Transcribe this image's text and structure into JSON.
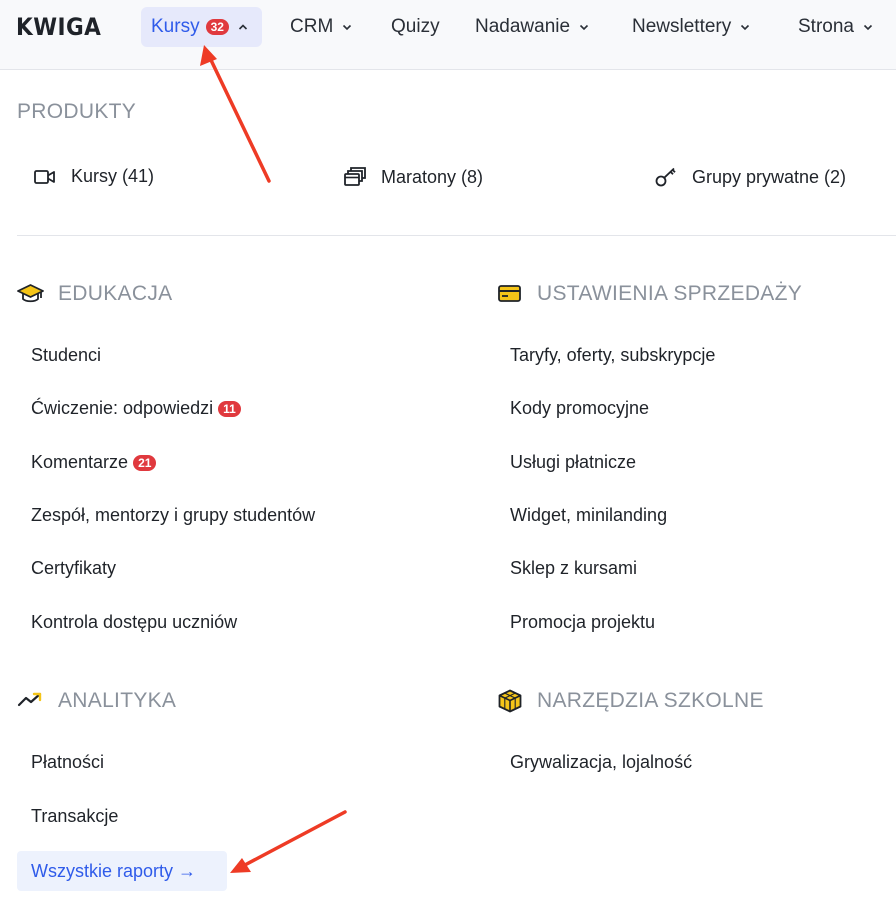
{
  "header": {
    "logo": "KWIGA",
    "nav": [
      {
        "label": "Kursy",
        "badge": "32",
        "active": true
      },
      {
        "label": "CRM"
      },
      {
        "label": "Quizy"
      },
      {
        "label": "Nadawanie"
      },
      {
        "label": "Newslettery"
      },
      {
        "label": "Strona"
      }
    ]
  },
  "products": {
    "heading": "PRODUKTY",
    "items": [
      {
        "label": "Kursy (41)",
        "icon": "video-icon"
      },
      {
        "label": "Maratony (8)",
        "icon": "layers-icon"
      },
      {
        "label": "Grupy prywatne (2)",
        "icon": "key-icon"
      }
    ]
  },
  "education": {
    "heading": "EDUKACJA",
    "icon": "graduation-cap-icon",
    "items": [
      {
        "label": "Studenci"
      },
      {
        "label": "Ćwiczenie: odpowiedzi",
        "badge": "11"
      },
      {
        "label": "Komentarze",
        "badge": "21"
      },
      {
        "label": "Zespół, mentorzy i grupy studentów"
      },
      {
        "label": "Certyfikaty"
      },
      {
        "label": "Kontrola dostępu uczniów"
      }
    ]
  },
  "sales": {
    "heading": "USTAWIENIA SPRZEDAŻY",
    "icon": "credit-card-icon",
    "items": [
      {
        "label": "Taryfy, oferty, subskrypcje"
      },
      {
        "label": "Kody promocyjne"
      },
      {
        "label": "Usługi płatnicze"
      },
      {
        "label": "Widget, minilanding"
      },
      {
        "label": "Sklep z kursami"
      },
      {
        "label": "Promocja projektu"
      }
    ]
  },
  "analytics": {
    "heading": "ANALITYKA",
    "icon": "trending-up-icon",
    "items": [
      {
        "label": "Płatności"
      },
      {
        "label": "Transakcje"
      }
    ],
    "all_reports": "Wszystkie raporty →"
  },
  "tools": {
    "heading": "NARZĘDZIA SZKOLNE",
    "icon": "cube-icon",
    "items": [
      {
        "label": "Grywalizacja, lojalność"
      }
    ]
  },
  "colors": {
    "accent": "#2f5bea",
    "badge": "#e0393e",
    "annotation_arrow": "#ee3b25",
    "icon_yellow": "#f5c518"
  }
}
